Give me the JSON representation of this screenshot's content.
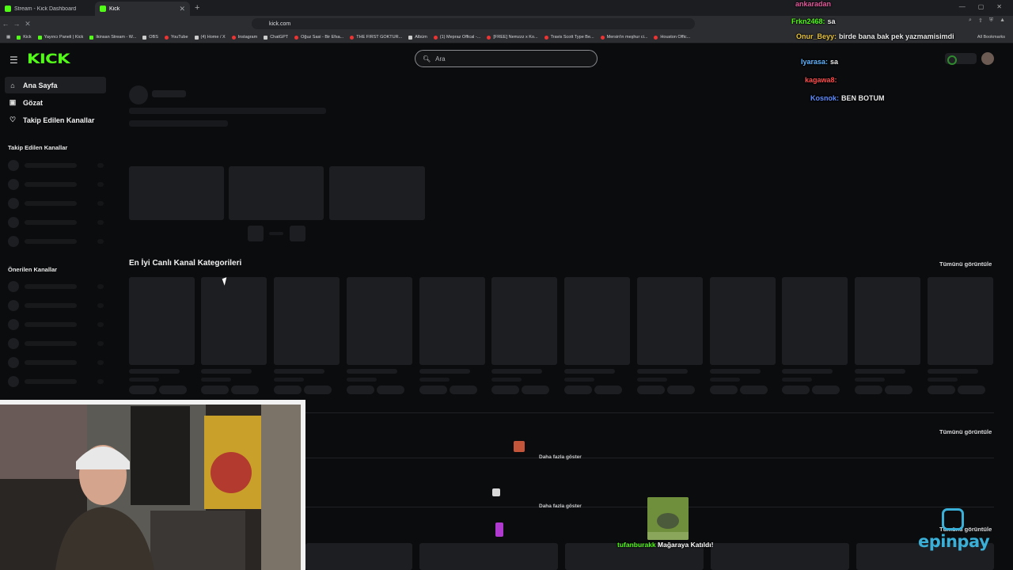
{
  "browser": {
    "tabs": [
      {
        "title": "Stream - Kick Dashboard"
      },
      {
        "title": "Kick"
      }
    ],
    "url": "kick.com",
    "bookmarks": [
      "Kick",
      "Yayıncı Paneli | Kick",
      "Ikinsan Stream - W...",
      "OBS",
      "YouTube",
      "(4) Home / X",
      "Instagram",
      "ChatGPT",
      "Oğuz Sasi - Bir Efsa...",
      "THE FIRST GOKTUR...",
      "Albüm",
      "(1) Mepraz Offical -...",
      "[FREE] Nemzzz x Ko...",
      "Travis Scott Type Be...",
      "Mersin'in meşhur ci...",
      "Houston Offic..."
    ],
    "all_bookmarks": "All Bookmarks"
  },
  "header": {
    "logo": "KICK",
    "search_placeholder": "Ara"
  },
  "sidebar": {
    "nav": [
      {
        "label": "Ana Sayfa",
        "icon": "home-icon"
      },
      {
        "label": "Gözat",
        "icon": "browse-icon"
      },
      {
        "label": "Takip Edilen Kanallar",
        "icon": "heart-icon"
      }
    ],
    "followed_heading": "Takip Edilen Kanallar",
    "recommended_heading": "Önerilen Kanallar"
  },
  "main": {
    "categories_title": "En İyi Canlı Kanal Kategorileri",
    "view_all": "Tümünü görüntüle",
    "show_more": "Daha fazla göster"
  },
  "overlay": {
    "chat": [
      {
        "user": "ankaradan",
        "message": "",
        "color": "#e05a9b"
      },
      {
        "user": "Frkn2468:",
        "message": "sa",
        "color": "#53fc18"
      },
      {
        "user": "Onur_Beyy:",
        "message": "birde bana bak pek yazmamisimdi",
        "color": "#e7c33c"
      },
      {
        "user": "Iyarasa:",
        "message": "sa",
        "color": "#5fb3ff"
      },
      {
        "user": "kagawa8:",
        "message": "",
        "color": "#ff4d4d"
      },
      {
        "user": "Kosnok:",
        "message": "BEN BOTUM",
        "color": "#5f8cff"
      }
    ],
    "alert_user": "tufanburakk",
    "alert_message": "Mağaraya Katıldı!",
    "sponsor": "epinpay",
    "colors": {
      "kick_green": "#53fc18",
      "sponsor_blue": "#3ab0d8"
    }
  }
}
